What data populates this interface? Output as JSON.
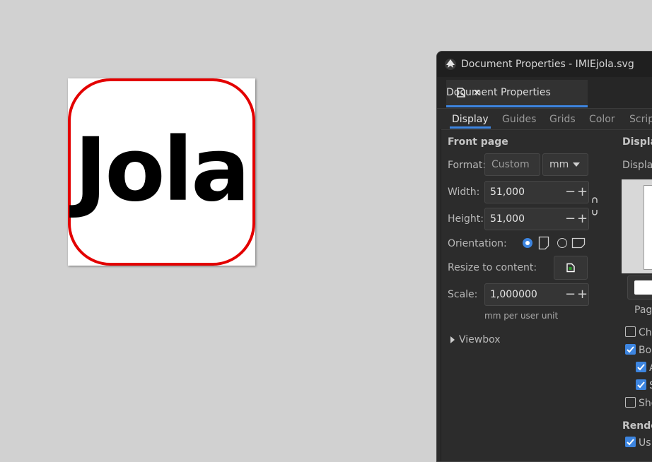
{
  "canvas": {
    "text": "Jola",
    "text_color": "#000000",
    "border_color": "#e30000"
  },
  "window": {
    "title": "Document Properties - IMIEjola.svg"
  },
  "dock_tab": {
    "label": "Document Properties",
    "close_glyph": "×"
  },
  "subtabs": [
    "Display",
    "Guides",
    "Grids",
    "Color",
    "Scrip"
  ],
  "front_page": {
    "section": "Front page",
    "format_label": "Format:",
    "format_value": "Custom",
    "unit_value": "mm",
    "width_label": "Width:",
    "width_value": "51,000",
    "height_label": "Height:",
    "height_value": "51,000",
    "orientation_label": "Orientation:",
    "resize_label": "Resize to content:",
    "scale_label": "Scale:",
    "scale_value": "1,000000",
    "scale_unit": "mm per user unit",
    "viewbox_label": "Viewbox",
    "minus": "−",
    "plus": "+"
  },
  "display": {
    "section": "Displa",
    "subtitle": "Displa",
    "page_label": "Pag",
    "checkboxes": [
      {
        "label": "Che",
        "checked": false
      },
      {
        "label": "Bo",
        "checked": true
      },
      {
        "label": "A",
        "checked": true
      },
      {
        "label": "S",
        "checked": true
      },
      {
        "label": "Sho",
        "checked": false
      }
    ],
    "render_section": "Rende",
    "render_check": {
      "label": "Us",
      "checked": true
    }
  },
  "colors": {
    "accent": "#3d85e0",
    "dialog_bg": "#2c2c2c",
    "canvas_bg": "#d1d1d1"
  }
}
